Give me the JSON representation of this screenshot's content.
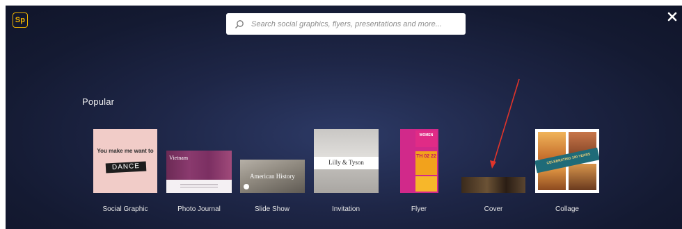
{
  "app": {
    "logo_text": "Sp"
  },
  "search": {
    "placeholder": "Search social graphics, flyers, presentations and more..."
  },
  "section": {
    "title": "Popular"
  },
  "cards": [
    {
      "label": "Social Graphic",
      "thumb_text": [
        "You make me want to",
        "DANCE"
      ]
    },
    {
      "label": "Photo Journal",
      "thumb_text": [
        "Vietnam"
      ]
    },
    {
      "label": "Slide Show",
      "thumb_text": [
        "American History"
      ]
    },
    {
      "label": "Invitation",
      "thumb_text": [
        "Lilly & Tyson"
      ]
    },
    {
      "label": "Flyer",
      "thumb_text": [
        "WOMEN",
        "TH 02 22"
      ]
    },
    {
      "label": "Cover",
      "thumb_text": []
    },
    {
      "label": "Collage",
      "thumb_text": [
        "CELEBRATING 100 YEARS"
      ]
    }
  ],
  "icons": {
    "search": "search-icon",
    "close": "close-icon"
  },
  "colors": {
    "logo": "#f0b400",
    "annotation_arrow": "#e0342a",
    "background": "#1e2647"
  }
}
